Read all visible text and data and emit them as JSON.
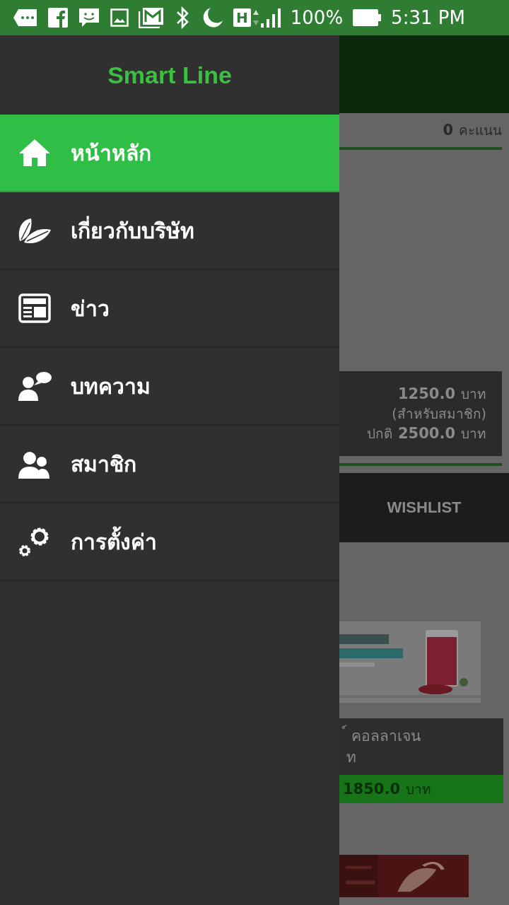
{
  "status_bar": {
    "network_type": "H",
    "battery": "100%",
    "time": "5:31 PM"
  },
  "drawer": {
    "title": "Smart Line",
    "items": [
      {
        "label": "หน้าหลัก",
        "selected": true
      },
      {
        "label": "เกี่ยวกับบริษัท",
        "selected": false
      },
      {
        "label": "ข่าว",
        "selected": false
      },
      {
        "label": "บทความ",
        "selected": false
      },
      {
        "label": "สมาชิก",
        "selected": false
      },
      {
        "label": "การตั้งค่า",
        "selected": false
      }
    ]
  },
  "background_page": {
    "points_value": "0",
    "points_label": "คะแนน",
    "price_box": {
      "member_price": "1250.0",
      "member_unit": "บาท",
      "member_note": "(สำหรับสมาชิก)",
      "normal_label": "ปกติ",
      "normal_price": "2500.0",
      "normal_unit": "บาท"
    },
    "wishlist_tab": "WISHLIST",
    "product": {
      "kind": "picture",
      "name_line_1": "์ คอลลาเจน",
      "name_line_2": "ท",
      "price": "1850.0",
      "unit": "บาท"
    }
  }
}
